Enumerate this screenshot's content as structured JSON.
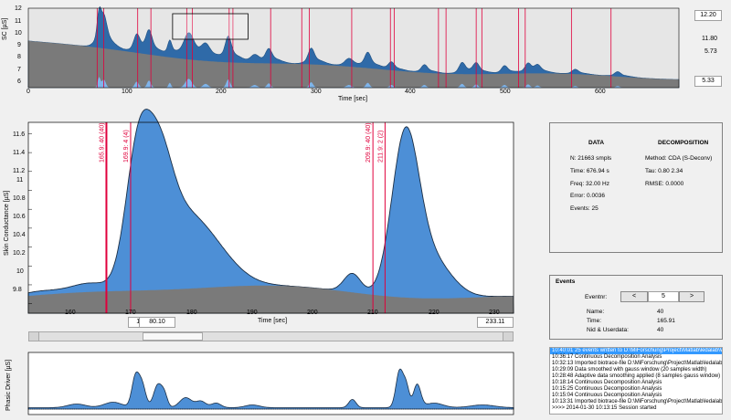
{
  "top_plot": {
    "ylabel": "SC [µS]",
    "xlabel": "Time [sec]",
    "yticks": [
      "6",
      "7",
      "8",
      "9",
      "10",
      "11",
      "12"
    ],
    "xticks": [
      "0",
      "100",
      "200",
      "300",
      "400",
      "500",
      "600"
    ],
    "right_values": {
      "top": "12.20",
      "mid1": "11.80",
      "mid2": "5.73",
      "bottom": "5.33"
    }
  },
  "main_plot": {
    "ylabel": "Skin Conductance [µS]",
    "xlabel": "Time [sec]",
    "yticks": [
      "9.8",
      "10",
      "10.2",
      "10.4",
      "10.6",
      "10.8",
      "11",
      "11.2",
      "11.4",
      "11.6"
    ],
    "xticks": [
      "160",
      "170",
      "180",
      "190",
      "200",
      "210",
      "220",
      "230"
    ],
    "markers": [
      {
        "label": "165.9:  40 (40)"
      },
      {
        "label": "169.9:  4 (4)"
      },
      {
        "label": "209.9:  40 (40)"
      },
      {
        "label": "211.9:  2 (2)"
      }
    ],
    "x_min_field": "153.01",
    "x_width_field": "80.10",
    "x_max_field": "233.11"
  },
  "phasic_plot": {
    "ylabel": "Phasic Driver [µS]"
  },
  "info": {
    "data_title": "DATA",
    "decomp_title": "DECOMPOSITION",
    "n": "N: 21663 smpls",
    "time": "Time: 676.94 s",
    "freq": "Freq: 32.00 Hz",
    "error": "Error: 0.0036",
    "events": "Events: 25",
    "method": "Method: CDA (S-Deconv)",
    "tau": "Tau: 0.80  2.34",
    "rmse": "RMSE: 0.0000"
  },
  "events_panel": {
    "title": "Events",
    "eventnr_label": "Eventnr:",
    "prev": "<",
    "value": "5",
    "next": ">",
    "name_label": "Name:",
    "name_value": "40",
    "time_label": "Time:",
    "time_value": "165.91",
    "nid_label": "Nid & Userdata:",
    "nid_value": "40"
  },
  "log": [
    "10:40:01 25 events written to D:\\MiForschung\\Project\\Matlab\\ledalab\\Workshop data\\\\T...",
    "10:36:17  Continuous Decomposition Analysis",
    "10:32:13  Imported biotrace-file D:\\MiForschung\\Project\\Matlab\\ledalab\\Workshop data\\T...",
    "10:29:09  Data smoothed with gauss window (20 samples width)",
    "10:28:48  Adaptive data smoothing applied (8 samples gauss window)",
    "10:18:14  Continuous Decomposition Analysis",
    "10:15:25  Continuous Decomposition Analysis",
    "10:15:04  Continuous Decomposition Analysis",
    "10:13:31  Imported biotrace-file D:\\MiForschung\\Project\\Matlab\\ledalab\\Workshop data\\plu...",
    ">>>> 2014-01-30 10:13:15 Session started"
  ],
  "colors": {
    "tonic": "#7a7a7a",
    "phasic": "#4d8fd6",
    "phasic_dark": "#2f6aa8",
    "marker": "#e0003c",
    "axes_bg": "#ffffff",
    "top_bg": "#e6e6e6"
  }
}
